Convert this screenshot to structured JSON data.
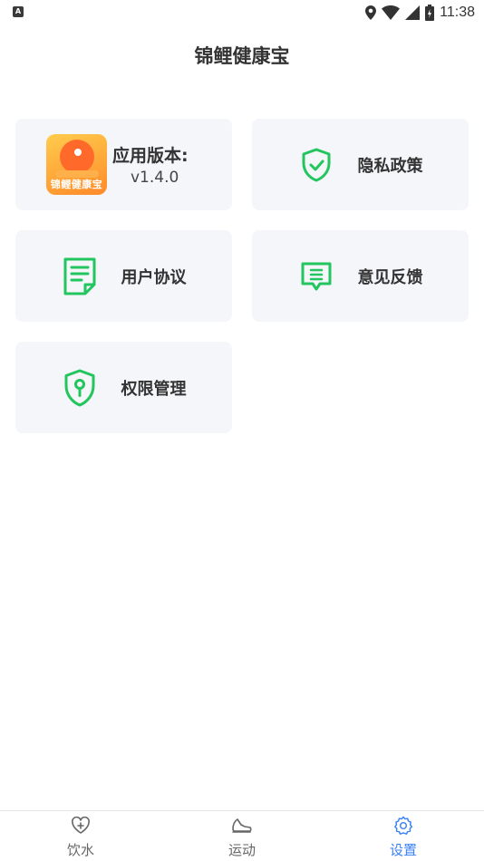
{
  "status_bar": {
    "indicator": "A",
    "time": "11:38"
  },
  "header": {
    "title": "锦鲤健康宝"
  },
  "version_card": {
    "logo_text": "锦鲤健康宝",
    "title": "应用版本:",
    "version": "v1.4.0"
  },
  "menu": {
    "privacy_label": "隐私政策",
    "agreement_label": "用户协议",
    "feedback_label": "意见反馈",
    "permission_label": "权限管理"
  },
  "tabbar": {
    "tabs": [
      {
        "label": "饮水",
        "icon": "heart-plus-icon",
        "active": false
      },
      {
        "label": "运动",
        "icon": "shoe-icon",
        "active": false
      },
      {
        "label": "设置",
        "icon": "gear-icon",
        "active": true
      }
    ]
  },
  "colors": {
    "accent_green": "#22c55e",
    "active_tab": "#3b82f6",
    "card_bg": "#f5f6fa"
  }
}
